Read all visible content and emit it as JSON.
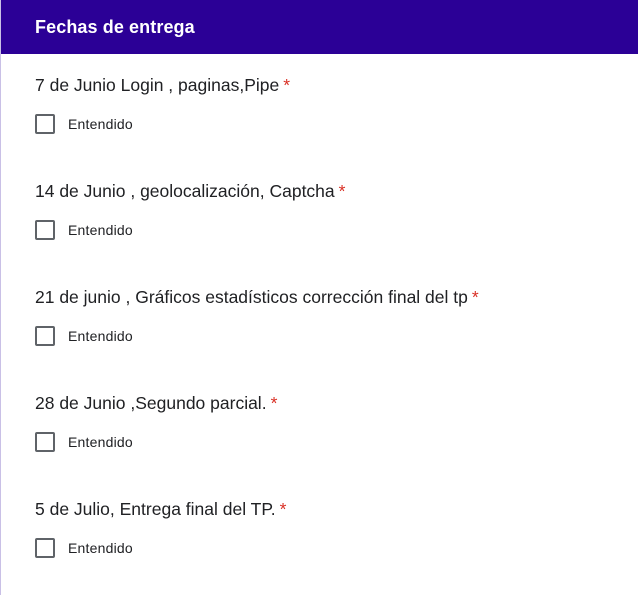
{
  "section": {
    "title": "Fechas de entrega"
  },
  "colors": {
    "header_bg": "#2b0096",
    "required_mark": "#d93025",
    "text": "#202124",
    "checkbox_border": "#5f6368"
  },
  "questions": [
    {
      "title": "7 de Junio Login , paginas,Pipe",
      "required_mark": "*",
      "option_label": "Entendido",
      "checked": false
    },
    {
      "title": "14 de Junio , geolocalización, Captcha",
      "required_mark": "*",
      "option_label": "Entendido",
      "checked": false
    },
    {
      "title": "21 de junio , Gráficos estadísticos corrección final del tp",
      "required_mark": "*",
      "option_label": "Entendido",
      "checked": false
    },
    {
      "title": "28 de Junio ,Segundo parcial.",
      "required_mark": "*",
      "option_label": "Entendido",
      "checked": false
    },
    {
      "title": "5 de Julio, Entrega final del TP.",
      "required_mark": "*",
      "option_label": "Entendido",
      "checked": false
    }
  ]
}
